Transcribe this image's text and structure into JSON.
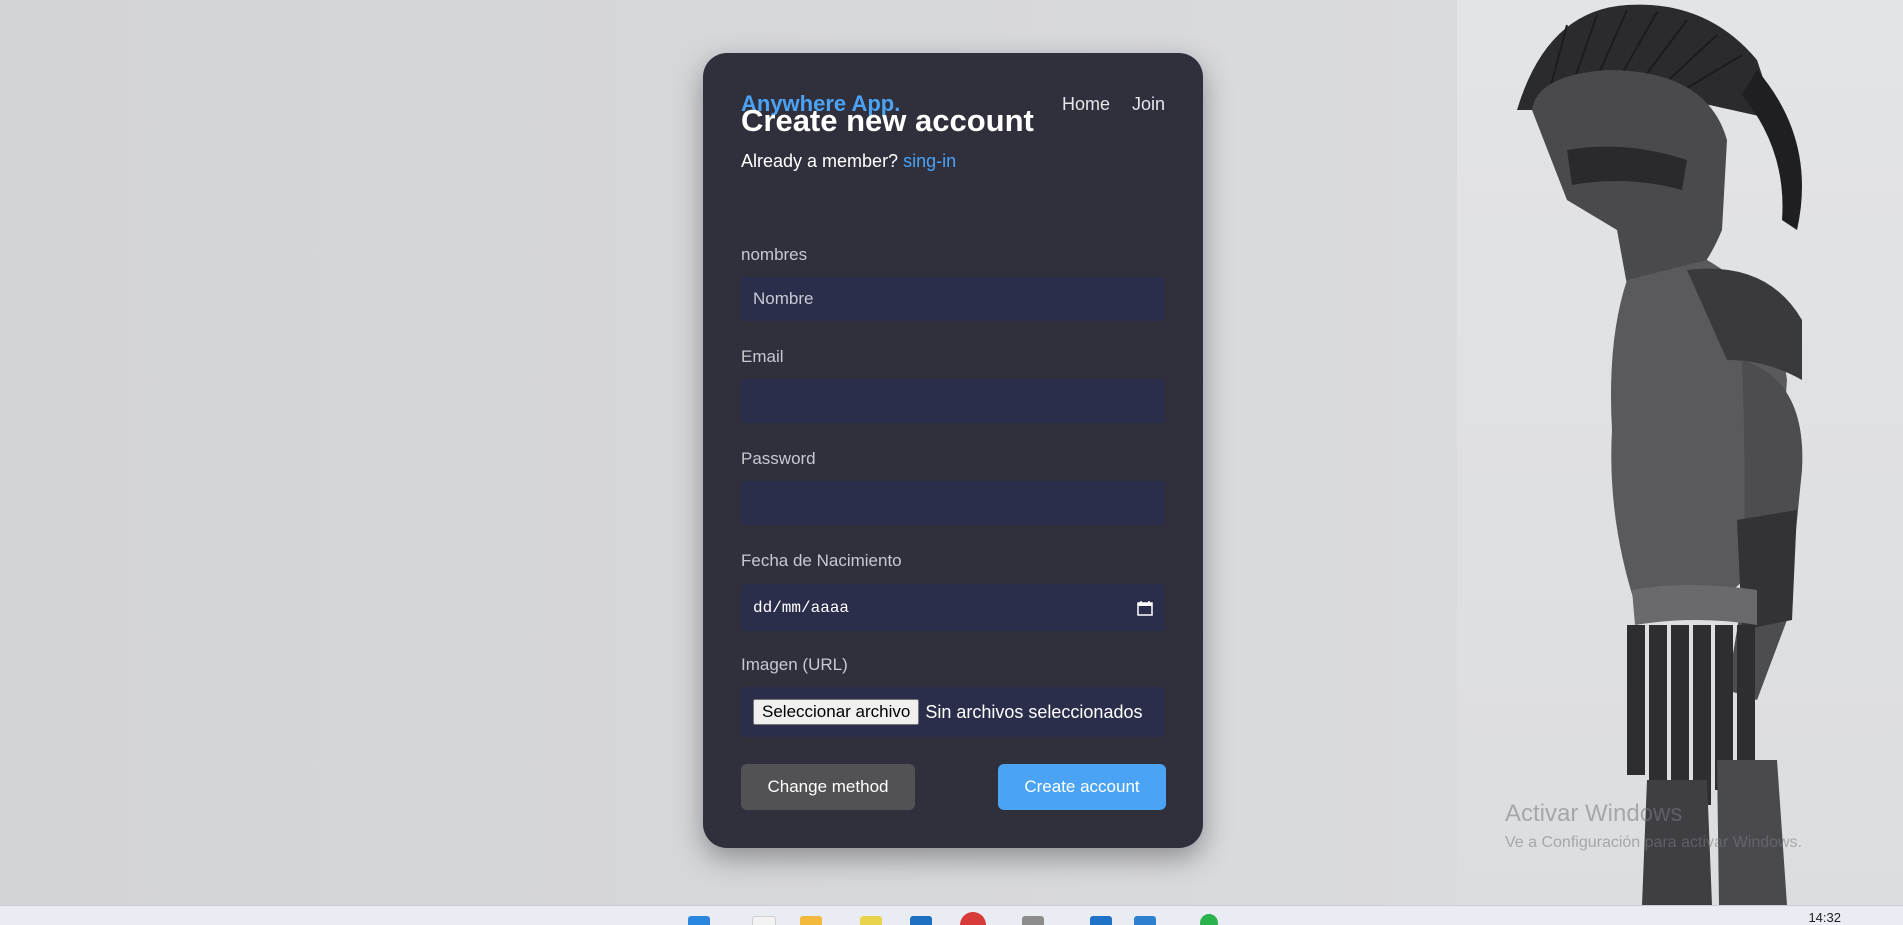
{
  "brand": "Anywhere App.",
  "nav": {
    "home": "Home",
    "join": "Join"
  },
  "form": {
    "title": "Create new account",
    "member_prompt": "Already a member?",
    "signin_link": "sing-in",
    "fields": {
      "name_label": "nombres",
      "name_placeholder": "Nombre",
      "email_label": "Email",
      "password_label": "Password",
      "birthdate_label": "Fecha de Nacimiento",
      "birthdate_placeholder": "dd/mm/aaaa",
      "image_label": "Imagen (URL)",
      "file_button": "Seleccionar archivo",
      "file_status": "Sin archivos seleccionados"
    },
    "buttons": {
      "change_method": "Change method",
      "create_account": "Create account"
    }
  },
  "watermark": {
    "title": "Activar Windows",
    "subtitle": "Ve a Configuración para activar Windows."
  },
  "taskbar": {
    "clock": "14:32"
  },
  "colors": {
    "accent": "#4aa3f5",
    "card_bg": "#302f3c",
    "field_bg": "#2b2e4a",
    "secondary_button": "#525153"
  }
}
